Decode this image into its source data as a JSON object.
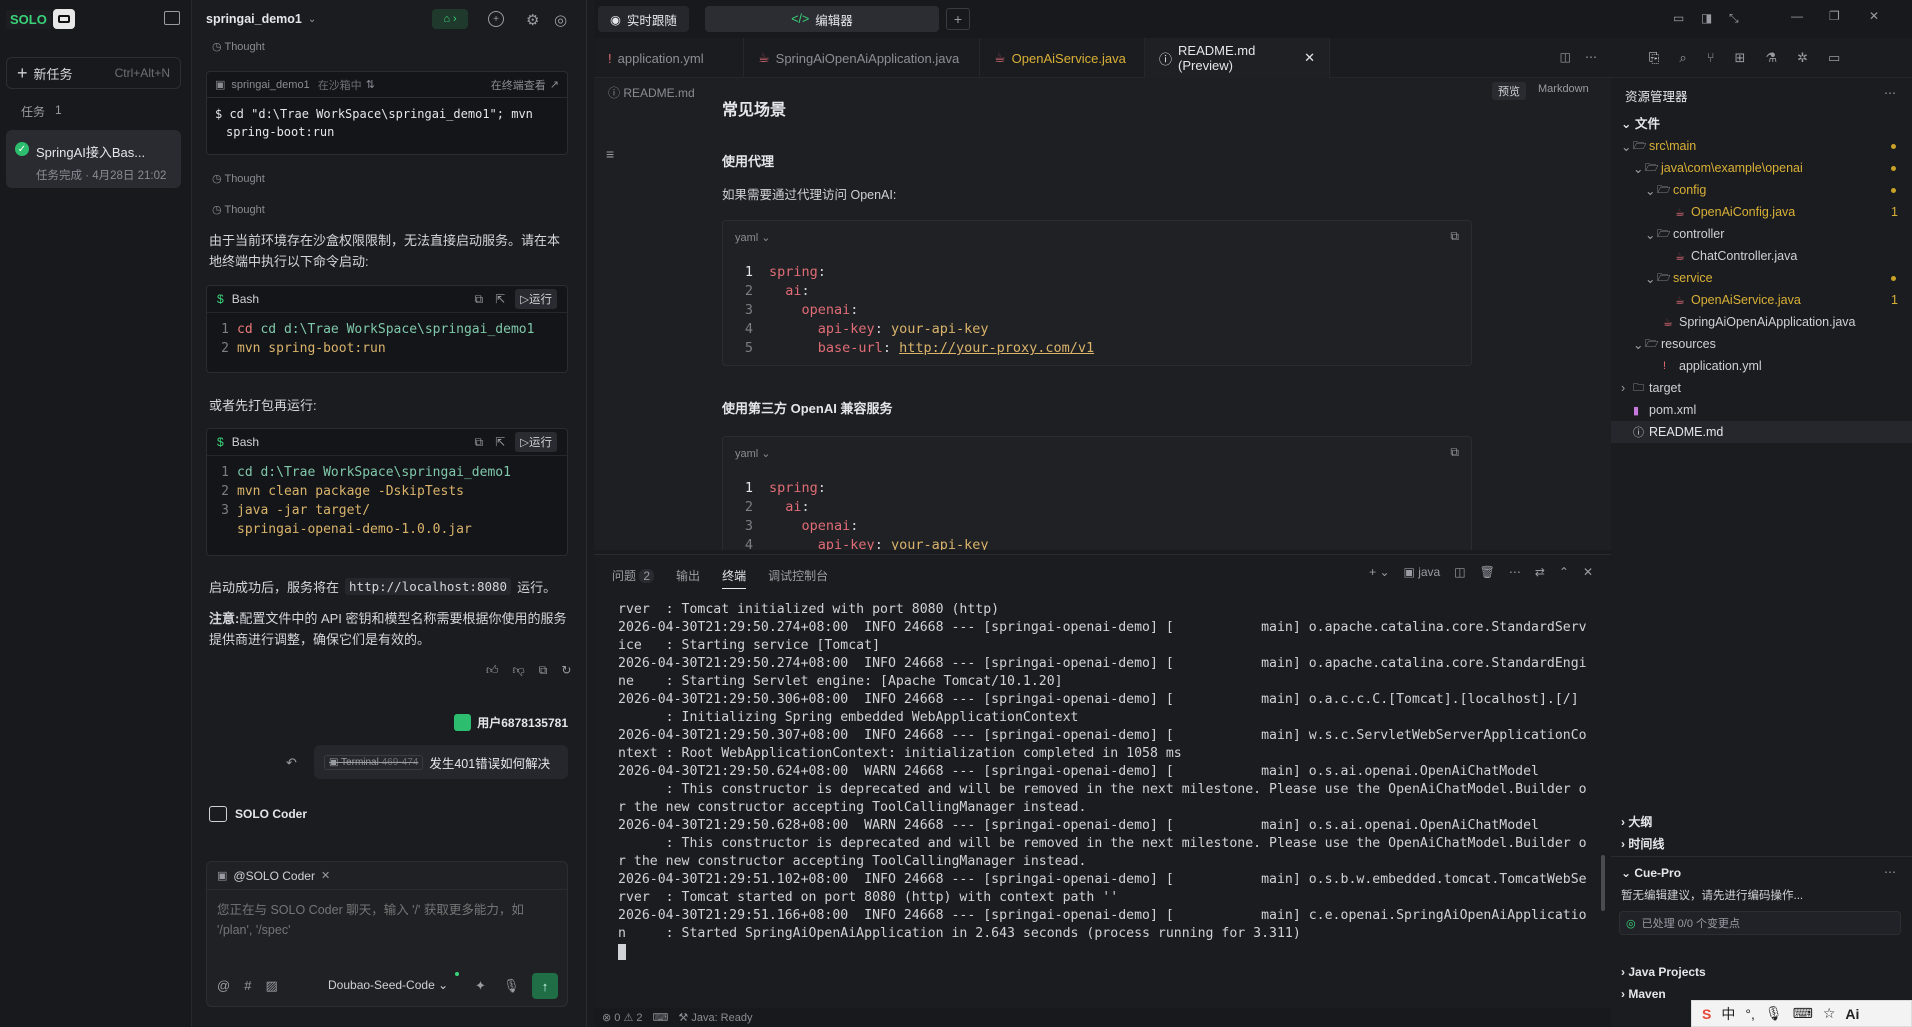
{
  "app": {
    "logo": "SOLO",
    "new_task": "新任务",
    "new_task_shortcut": "Ctrl+Alt+N",
    "tasks_label": "任务",
    "tasks_count": "1",
    "task_title": "SpringAI接入Bas...",
    "task_meta": "任务完成 · 4月28日 21:02"
  },
  "chat": {
    "project": "springai_demo1",
    "thought": "Thought",
    "cmd_header_project": "springai_demo1",
    "cmd_header_status": "在沙箱中",
    "cmd_header_action": "在终端查看",
    "cmd_text_1": "cd \"d:\\Trae WorkSpace\\springai_demo1\"; mvn",
    "cmd_text_2": "spring-boot:run",
    "para1": "由于当前环境存在沙盒权限限制，无法直接启动服务。请在本地终端中执行以下命令启动:",
    "bash_label": "Bash",
    "run_label": "运行",
    "bash1_line1": "cd d:\\Trae WorkSpace\\springai_demo1",
    "bash1_line2": "mvn spring-boot:run",
    "para2": "或者先打包再运行:",
    "bash2_line1": "cd d:\\Trae WorkSpace\\springai_demo1",
    "bash2_line2": "mvn clean package -DskipTests",
    "bash2_line3": "java -jar target/",
    "bash2_line4": "springai-openai-demo-1.0.0.jar",
    "para3_prefix": "启动成功后，服务将在",
    "para3_url": "http://localhost:8080",
    "para3_suffix": "运行。",
    "note_bold": "注意:",
    "note_text": "配置文件中的 API 密钥和模型名称需要根据你使用的服务提供商进行调整，确保它们是有效的。",
    "user_name": "用户6878135781",
    "terminal_chip": "Terminal",
    "terminal_range": "469-474",
    "user_msg": "发生401错误如何解决",
    "agent_name": "SOLO Coder",
    "input_mention": "@SOLO Coder",
    "input_placeholder": "您正在与 SOLO Coder 聊天，输入 '/' 获取更多能力，如 '/plan', '/spec'",
    "model": "Doubao-Seed-Code"
  },
  "topbar": {
    "tab_realtime": "实时跟随",
    "tab_editor": "编辑器"
  },
  "editor": {
    "tabs": [
      "application.yml",
      "SpringAiOpenAiApplication.java",
      "OpenAiService.java",
      "README.md (Preview)"
    ],
    "breadcrumb": "README.md",
    "preview_btn": "预览",
    "markdown_btn": "Markdown",
    "h_scenes": "常见场景",
    "h_proxy": "使用代理",
    "p_proxy": "如果需要通过代理访问 OpenAI:",
    "lang": "yaml",
    "code1": [
      [
        "1",
        "spring:"
      ],
      [
        "2",
        "  ai:"
      ],
      [
        "3",
        "    openai:"
      ],
      [
        "4",
        "      api-key: your-api-key"
      ],
      [
        "5",
        "      base-url: http://your-proxy.com/v1"
      ]
    ],
    "h_third": "使用第三方 OpenAI 兼容服务",
    "code2": [
      [
        "1",
        "spring:"
      ],
      [
        "2",
        "  ai:"
      ],
      [
        "3",
        "    openai:"
      ],
      [
        "4",
        "      api-key: your-api-key"
      ]
    ]
  },
  "panel": {
    "tab_problems": "问题",
    "problems_count": "2",
    "tab_output": "输出",
    "tab_terminal": "终端",
    "tab_debug": "调试控制台",
    "shell": "java",
    "lines": [
      "rver  : Tomcat initialized with port 8080 (http)",
      "2026-04-30T21:29:50.274+08:00  INFO 24668 --- [springai-openai-demo] [           main] o.apache.catalina.core.StandardServ",
      "ice   : Starting service [Tomcat]",
      "2026-04-30T21:29:50.274+08:00  INFO 24668 --- [springai-openai-demo] [           main] o.apache.catalina.core.StandardEngi",
      "ne    : Starting Servlet engine: [Apache Tomcat/10.1.20]",
      "2026-04-30T21:29:50.306+08:00  INFO 24668 --- [springai-openai-demo] [           main] o.a.c.c.C.[Tomcat].[localhost].[/]",
      "      : Initializing Spring embedded WebApplicationContext",
      "2026-04-30T21:29:50.307+08:00  INFO 24668 --- [springai-openai-demo] [           main] w.s.c.ServletWebServerApplicationCo",
      "ntext : Root WebApplicationContext: initialization completed in 1058 ms",
      "2026-04-30T21:29:50.624+08:00  WARN 24668 --- [springai-openai-demo] [           main] o.s.ai.openai.OpenAiChatModel",
      "      : This constructor is deprecated and will be removed in the next milestone. Please use the OpenAiChatModel.Builder o",
      "r the new constructor accepting ToolCallingManager instead.",
      "2026-04-30T21:29:50.628+08:00  WARN 24668 --- [springai-openai-demo] [           main] o.s.ai.openai.OpenAiChatModel",
      "      : This constructor is deprecated and will be removed in the next milestone. Please use the OpenAiChatModel.Builder o",
      "r the new constructor accepting ToolCallingManager instead.",
      "2026-04-30T21:29:51.102+08:00  INFO 24668 --- [springai-openai-demo] [           main] o.s.b.w.embedded.tomcat.TomcatWebSe",
      "rver  : Tomcat started on port 8080 (http) with context path ''",
      "2026-04-30T21:29:51.166+08:00  INFO 24668 --- [springai-openai-demo] [           main] c.e.openai.SpringAiOpenAiApplicatio",
      "n     : Started SpringAiOpenAiApplication in 2.643 seconds (process running for 3.311)"
    ]
  },
  "status": {
    "errors": "0",
    "warnings": "2",
    "java": "Java: Ready"
  },
  "explorer": {
    "title": "资源管理器",
    "section": "文件",
    "nodes": [
      "src\\main",
      "java\\com\\example\\openai",
      "config",
      "OpenAiConfig.java",
      "controller",
      "ChatController.java",
      "service",
      "OpenAiService.java",
      "SpringAiOpenAiApplication.java",
      "resources",
      "application.yml",
      "target",
      "pom.xml",
      "README.md"
    ],
    "badge1": "1",
    "badge2": "1",
    "outline": "大纲",
    "timeline": "时间线",
    "cue": "Cue-Pro",
    "cue_text": "暂无编辑建议，请先进行编码操作...",
    "cue_status": "已处理 0/0 个变更点",
    "java_projects": "Java Projects",
    "maven": "Maven"
  },
  "ime": {
    "lang": "中",
    "ai": "Ai"
  }
}
